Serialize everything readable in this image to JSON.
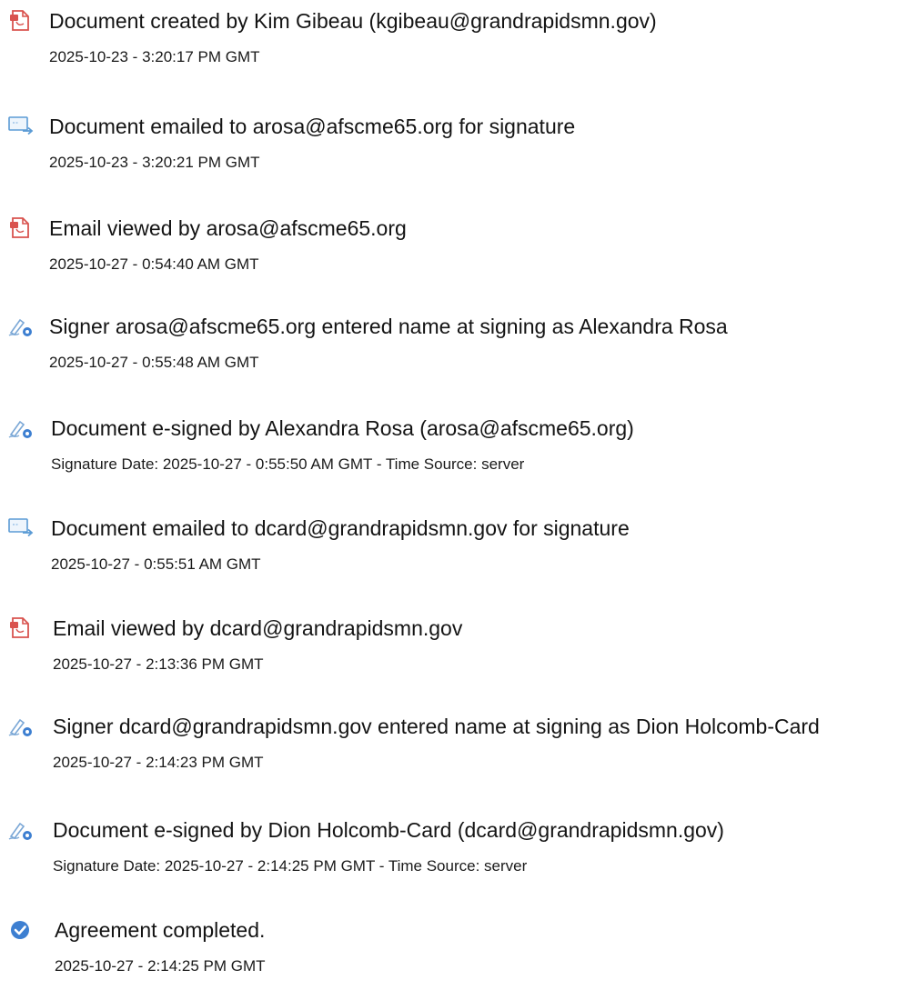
{
  "audit_log": {
    "entries": [
      {
        "icon": "document-created-icon",
        "text": "Document created by Kim Gibeau (kgibeau@grandrapidsmn.gov)",
        "time": "2025-10-23 - 3:20:17 PM GMT"
      },
      {
        "icon": "email-sent-icon",
        "text": "Document emailed to arosa@afscme65.org for signature",
        "time": "2025-10-23 - 3:20:21 PM GMT"
      },
      {
        "icon": "email-viewed-icon",
        "text": "Email viewed by arosa@afscme65.org",
        "time": "2025-10-27 - 0:54:40 AM GMT"
      },
      {
        "icon": "signer-pen-icon",
        "text": "Signer arosa@afscme65.org entered name at signing as Alexandra Rosa",
        "time": "2025-10-27 - 0:55:48 AM GMT"
      },
      {
        "icon": "esign-pen-icon",
        "text": "Document e-signed by Alexandra Rosa (arosa@afscme65.org)",
        "time": "Signature Date: 2025-10-27 - 0:55:50 AM GMT - Time Source: server"
      },
      {
        "icon": "email-sent-icon",
        "text": "Document emailed to dcard@grandrapidsmn.gov for signature",
        "time": "2025-10-27 - 0:55:51 AM GMT"
      },
      {
        "icon": "email-viewed-icon",
        "text": "Email viewed by dcard@grandrapidsmn.gov",
        "time": "2025-10-27 - 2:13:36 PM GMT"
      },
      {
        "icon": "signer-pen-icon",
        "text": "Signer dcard@grandrapidsmn.gov entered name at signing as Dion Holcomb-Card",
        "time": "2025-10-27 - 2:14:23 PM GMT"
      },
      {
        "icon": "esign-pen-icon",
        "text": "Document e-signed by Dion Holcomb-Card (dcard@grandrapidsmn.gov)",
        "time": "Signature Date: 2025-10-27 - 2:14:25 PM GMT - Time Source: server"
      },
      {
        "icon": "agreement-completed-check-icon",
        "text": "Agreement completed.",
        "time": "2025-10-27 - 2:14:25 PM GMT"
      }
    ]
  },
  "colors": {
    "document_icon": "#d9534f",
    "email_icon": "#5b9bd5",
    "pen_icon": "#7aa7d6",
    "check_icon": "#3d7fd1",
    "text": "#141414"
  }
}
